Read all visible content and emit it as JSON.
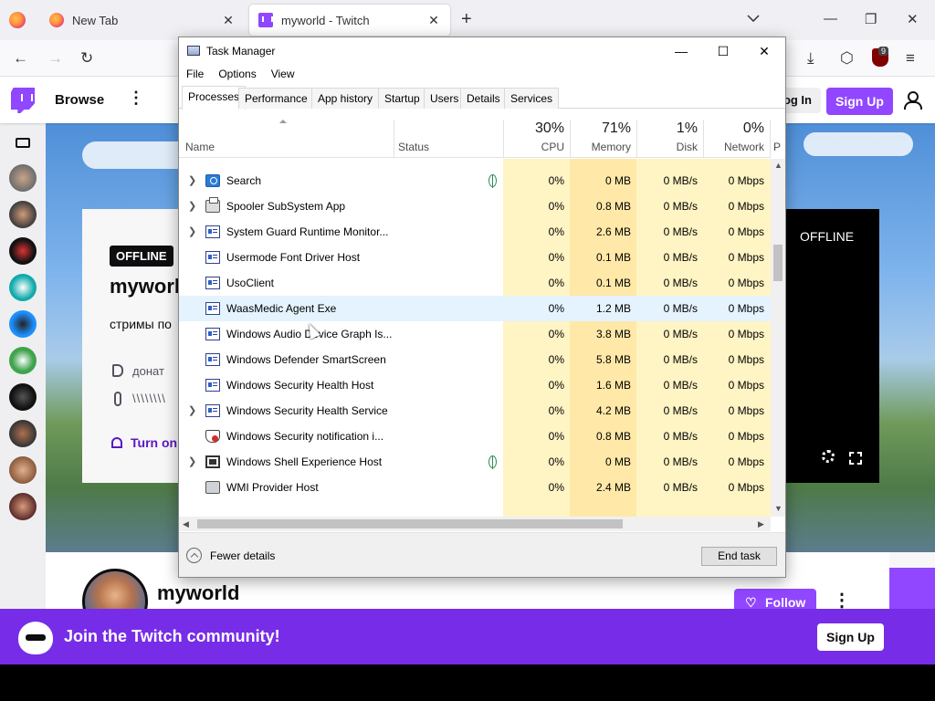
{
  "browser": {
    "tabs": [
      {
        "title": "New Tab",
        "favicon": "firefox-icon",
        "active": false
      },
      {
        "title": "myworld - Twitch",
        "favicon": "twitch-icon",
        "active": true
      }
    ],
    "new_tab_symbol": "+",
    "tabs_list_symbol": "⌄",
    "window_controls": {
      "minimize": "—",
      "restore": "❐",
      "close": "✕"
    },
    "nav": {
      "back": "←",
      "forward": "→",
      "reload": "↻",
      "downloads": "⤓",
      "extensions": "⬡",
      "menu": "≡"
    },
    "extension_badge": "9"
  },
  "twitch": {
    "brand_color": "#9146ff",
    "top": {
      "browse": "Browse",
      "more": "⋮",
      "login": "Log In",
      "signup": "Sign Up"
    },
    "info_card": {
      "status": "OFFLINE",
      "channel": "myworld",
      "description": "стримы по",
      "donate": "донат",
      "link2": "\\\\\\\\\\\\\\\\",
      "turn_on": "Turn on"
    },
    "player": {
      "status": "OFFLINE"
    },
    "channel_bar": {
      "name": "myworld",
      "follow": "Follow",
      "heart": "♡",
      "more": "⋮"
    },
    "join_bar": {
      "text": "Join the Twitch community!",
      "signup": "Sign Up"
    }
  },
  "task_manager": {
    "title": "Task Manager",
    "controls": {
      "minimize": "—",
      "maximize": "☐",
      "close": "✕"
    },
    "menu": [
      "File",
      "Options",
      "View"
    ],
    "tabs": [
      "Processes",
      "Performance",
      "App history",
      "Startup",
      "Users",
      "Details",
      "Services"
    ],
    "active_tab": "Processes",
    "columns": {
      "name": "Name",
      "status": "Status",
      "cpu": {
        "pct": "30%",
        "label": "CPU"
      },
      "memory": {
        "pct": "71%",
        "label": "Memory"
      },
      "disk": {
        "pct": "1%",
        "label": "Disk"
      },
      "network": {
        "pct": "0%",
        "label": "Network"
      },
      "power_partial": "P"
    },
    "heat_color": "#fff4c4",
    "heat_color_strong": "#ffe8a8",
    "processes": [
      {
        "name": "Search",
        "icon": "search-icon",
        "expandable": true,
        "eco": true,
        "cpu": "0%",
        "memory": "0 MB",
        "disk": "0 MB/s",
        "network": "0 Mbps"
      },
      {
        "name": "Spooler SubSystem App",
        "icon": "printer-icon",
        "expandable": true,
        "eco": false,
        "cpu": "0%",
        "memory": "0.8 MB",
        "disk": "0 MB/s",
        "network": "0 Mbps"
      },
      {
        "name": "System Guard Runtime Monitor...",
        "icon": "window-icon",
        "expandable": true,
        "eco": false,
        "cpu": "0%",
        "memory": "2.6 MB",
        "disk": "0 MB/s",
        "network": "0 Mbps"
      },
      {
        "name": "Usermode Font Driver Host",
        "icon": "window-icon",
        "expandable": false,
        "eco": false,
        "cpu": "0%",
        "memory": "0.1 MB",
        "disk": "0 MB/s",
        "network": "0 Mbps"
      },
      {
        "name": "UsoClient",
        "icon": "window-icon",
        "expandable": false,
        "eco": false,
        "cpu": "0%",
        "memory": "0.1 MB",
        "disk": "0 MB/s",
        "network": "0 Mbps"
      },
      {
        "name": "WaasMedic Agent Exe",
        "icon": "window-icon",
        "expandable": false,
        "eco": false,
        "cpu": "0%",
        "memory": "1.2 MB",
        "disk": "0 MB/s",
        "network": "0 Mbps",
        "hover": true
      },
      {
        "name": "Windows Audio Device Graph Is...",
        "icon": "window-icon",
        "expandable": false,
        "eco": false,
        "cpu": "0%",
        "memory": "3.8 MB",
        "disk": "0 MB/s",
        "network": "0 Mbps"
      },
      {
        "name": "Windows Defender SmartScreen",
        "icon": "window-icon",
        "expandable": false,
        "eco": false,
        "cpu": "0%",
        "memory": "5.8 MB",
        "disk": "0 MB/s",
        "network": "0 Mbps"
      },
      {
        "name": "Windows Security Health Host",
        "icon": "window-icon",
        "expandable": false,
        "eco": false,
        "cpu": "0%",
        "memory": "1.6 MB",
        "disk": "0 MB/s",
        "network": "0 Mbps"
      },
      {
        "name": "Windows Security Health Service",
        "icon": "window-icon",
        "expandable": true,
        "eco": false,
        "cpu": "0%",
        "memory": "4.2 MB",
        "disk": "0 MB/s",
        "network": "0 Mbps"
      },
      {
        "name": "Windows Security notification i...",
        "icon": "shield-icon",
        "expandable": false,
        "eco": false,
        "cpu": "0%",
        "memory": "0.8 MB",
        "disk": "0 MB/s",
        "network": "0 Mbps"
      },
      {
        "name": "Windows Shell Experience Host",
        "icon": "dark-window-icon",
        "expandable": true,
        "eco": true,
        "cpu": "0%",
        "memory": "0 MB",
        "disk": "0 MB/s",
        "network": "0 Mbps"
      },
      {
        "name": "WMI Provider Host",
        "icon": "wmi-icon",
        "expandable": false,
        "eco": false,
        "cpu": "0%",
        "memory": "2.4 MB",
        "disk": "0 MB/s",
        "network": "0 Mbps"
      }
    ],
    "footer": {
      "fewer_details": "Fewer details",
      "end_task": "End task"
    }
  }
}
